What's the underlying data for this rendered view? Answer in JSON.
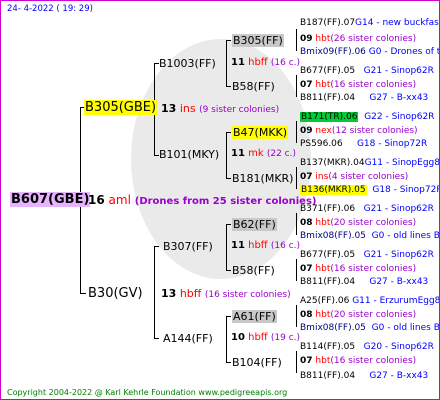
{
  "date": "24-  4-2022  ( 19:  29)",
  "copyright": "Copyright 2004-2022 @ Karl Kehrle Foundation    www.pedigreeapis.org",
  "gen0": {
    "id": "B607(GBE)",
    "num": "16",
    "type": "aml",
    "sisters": "(Drones from 25 sister colonies)"
  },
  "gen1": [
    {
      "id": "B305(GBE)",
      "num": "13",
      "type": "ins",
      "sisters": "(9 sister colonies)"
    },
    {
      "id": "B30(GV)",
      "num": "13",
      "type": "hbff",
      "sisters": "(16 sister colonies)"
    }
  ],
  "gen2": [
    {
      "id": "B1003(FF)",
      "num": "11",
      "type": "hbff",
      "sisters": "(16 c.)"
    },
    {
      "id": "B101(MKY)",
      "num": "11",
      "type": "mk",
      "sisters": "(22 c.)"
    },
    {
      "id": "B307(FF)",
      "num": "11",
      "type": "hbff",
      "sisters": "(16 c.)"
    },
    {
      "id": "A144(FF)",
      "num": "10",
      "type": "hbff",
      "sisters": "(19 c.)"
    }
  ],
  "gen3": [
    {
      "id": "B305(FF)",
      "num": "09",
      "type": "hbt",
      "sisters": "(26 sister colonies)"
    },
    {
      "id": "B58(FF)",
      "num": "07",
      "type": "hbt",
      "sisters": "(16 sister colonies)"
    },
    {
      "id": "B47(MKK)",
      "num": "09",
      "type": "nex",
      "sisters": "(12 sister colonies)"
    },
    {
      "id": "B181(MKR)",
      "num": "07",
      "type": "ins",
      "sisters": "(4 sister colonies)"
    },
    {
      "id": "B62(FF)",
      "num": "08",
      "type": "hbt",
      "sisters": "(20 sister colonies)"
    },
    {
      "id": "B58(FF)",
      "num": "07",
      "type": "hbt",
      "sisters": "(16 sister colonies)"
    },
    {
      "id": "A61(FF)",
      "num": "08",
      "type": "hbt",
      "sisters": "(20 sister colonies)"
    },
    {
      "id": "B104(FF)",
      "num": "07",
      "type": "hbt",
      "sisters": "(16 sister colonies)"
    }
  ],
  "gen4": [
    {
      "id": "B187(FF).07",
      "info": "G14 - new buckfas"
    },
    {
      "id": "Bmix09(FF).06",
      "info": "G0 - Drones of t"
    },
    {
      "id": "B677(FF).05",
      "info": "G21 - Sinop62R"
    },
    {
      "id": "B811(FF).04",
      "info": "G27 - B-xx43"
    },
    {
      "id": "B171(TR).06",
      "info": "G22 - Sinop62R"
    },
    {
      "id": "PS596.06",
      "info": "G18 - Sinop72R"
    },
    {
      "id": "B137(MKR).04",
      "info": "G11 - SinopEgg86R"
    },
    {
      "id": "B136(MKR).05",
      "info": "G18 - Sinop72R"
    },
    {
      "id": "B371(FF).06",
      "info": "G21 - Sinop62R"
    },
    {
      "id": "Bmix08(FF).05",
      "info": "G0 - old lines B"
    },
    {
      "id": "B677(FF).05",
      "info": "G21 - Sinop62R"
    },
    {
      "id": "B811(FF).04",
      "info": "G27 - B-xx43"
    },
    {
      "id": "A25(FF).06",
      "info": "G11 - ErzurumEgg8"
    },
    {
      "id": "Bmix08(FF).05",
      "info": "G0 - old lines B"
    },
    {
      "id": "B114(FF).05",
      "info": "G20 - Sinop62R"
    },
    {
      "id": "B811(FF).04",
      "info": "G27 - B-xx43"
    }
  ]
}
